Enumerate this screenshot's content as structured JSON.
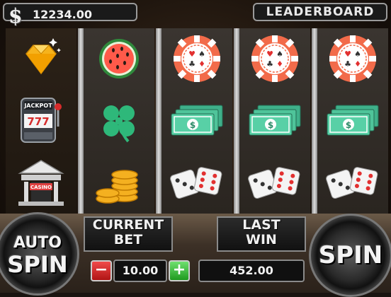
{
  "header": {
    "currency_symbol": "$",
    "balance": "12234.00",
    "leaderboard_label": "LEADERBOARD"
  },
  "reels": [
    {
      "symbols": [
        "diamond-icon",
        "jackpot-slot-machine-icon",
        "casino-building-icon"
      ],
      "slot_labels": {
        "machine": "JACKPOT",
        "digits": "777",
        "building": "CASINO"
      }
    },
    {
      "symbols": [
        "watermelon-icon",
        "clover-icon",
        "gold-coins-icon"
      ]
    },
    {
      "symbols": [
        "poker-chip-icon",
        "cash-stack-icon",
        "dice-icon"
      ]
    },
    {
      "symbols": [
        "poker-chip-icon",
        "cash-stack-icon",
        "dice-icon"
      ]
    },
    {
      "symbols": [
        "poker-chip-icon",
        "cash-stack-icon",
        "dice-icon"
      ]
    }
  ],
  "controls": {
    "auto_spin_line1": "AUTO",
    "auto_spin_line2": "SPIN",
    "current_bet_line1": "CURRENT",
    "current_bet_line2": "BET",
    "minus_label": "−",
    "bet_value": "10.00",
    "plus_label": "+",
    "last_win_line1": "LAST",
    "last_win_line2": "WIN",
    "last_win_value": "452.00",
    "spin_label": "SPIN"
  },
  "colors": {
    "chip": "#f26b4a",
    "cash": "#4fc49a",
    "clover": "#2eb87a",
    "diamond": "#f4b020",
    "minus": "#d32222",
    "plus": "#2fb82f"
  }
}
